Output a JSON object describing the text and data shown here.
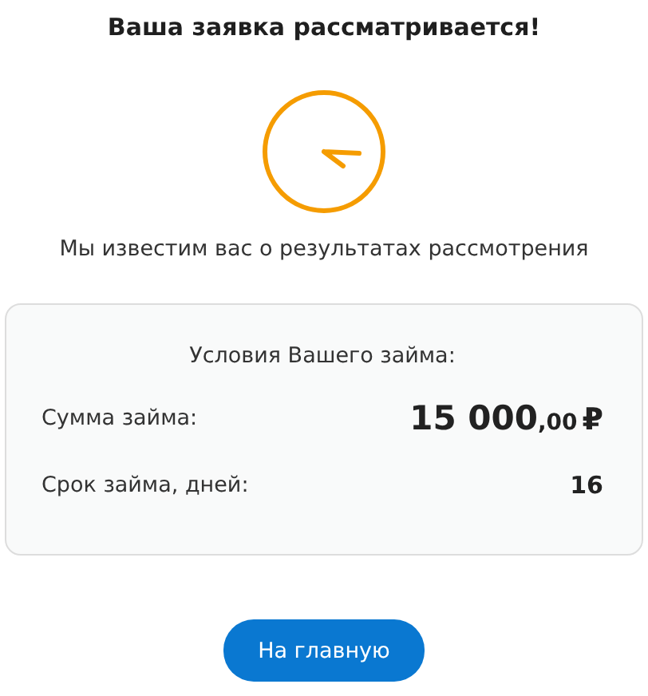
{
  "title": "Ваша заявка рассматривается!",
  "message": "Мы известим вас о результатах рассмотрения",
  "terms": {
    "heading": "Условия Вашего займа:",
    "rows": [
      {
        "kind": "amount",
        "label": "Сумма займа:",
        "whole": "15 000",
        "fraction": ",00",
        "currency": "₽"
      },
      {
        "kind": "plain",
        "label": "Срок займа, дней:",
        "value": "16"
      }
    ]
  },
  "button": "На главную"
}
